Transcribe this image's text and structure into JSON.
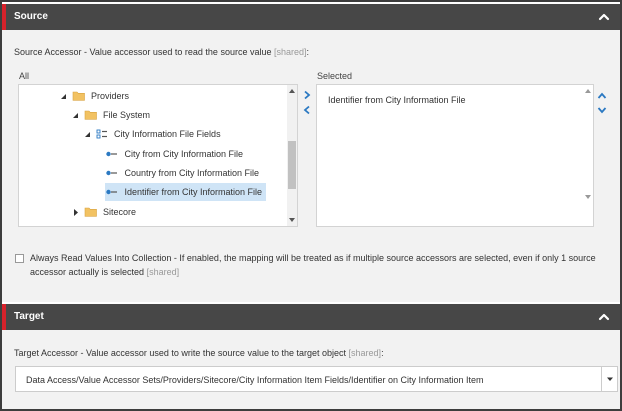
{
  "source": {
    "header_title": "Source",
    "accessor_label": "Source Accessor - Value accessor used to read the source value",
    "shared_tag": "[shared]",
    "all_label": "All",
    "selected_label": "Selected",
    "tree": [
      {
        "label": "Providers",
        "icon": "folder-icon",
        "expander": "expanded"
      },
      {
        "label": "File System",
        "icon": "folder-icon",
        "expander": "expanded"
      },
      {
        "label": "City Information File Fields",
        "icon": "fields-icon",
        "expander": "expanded"
      },
      {
        "label": "City from City Information File",
        "icon": "field-item-icon",
        "expander": "none"
      },
      {
        "label": "Country from City Information File",
        "icon": "field-item-icon",
        "expander": "none"
      },
      {
        "label": "Identifier from City Information File",
        "icon": "field-item-icon",
        "expander": "none",
        "selected": true
      },
      {
        "label": "Sitecore",
        "icon": "folder-icon",
        "expander": "collapsed"
      }
    ],
    "selected_items": [
      "Identifier from City Information File"
    ],
    "checkbox_text": "Always Read Values Into Collection - If enabled, the mapping will be treated as if multiple source accessors are selected, even if only 1 source accessor actually is selected",
    "checkbox_checked": false
  },
  "target": {
    "header_title": "Target",
    "accessor_label": "Target Accessor - Value accessor used to write the source value to the target object",
    "shared_tag": "[shared]",
    "select_value": "Data Access/Value Accessor Sets/Providers/Sitecore/City Information Item Fields/Identifier on City Information Item"
  },
  "colors": {
    "header_bg": "#474747",
    "header_accent": "#d6222b",
    "link_blue": "#2b79c2",
    "selection_bg": "#cfe4f6",
    "folder_yellow": "#f2c262"
  }
}
